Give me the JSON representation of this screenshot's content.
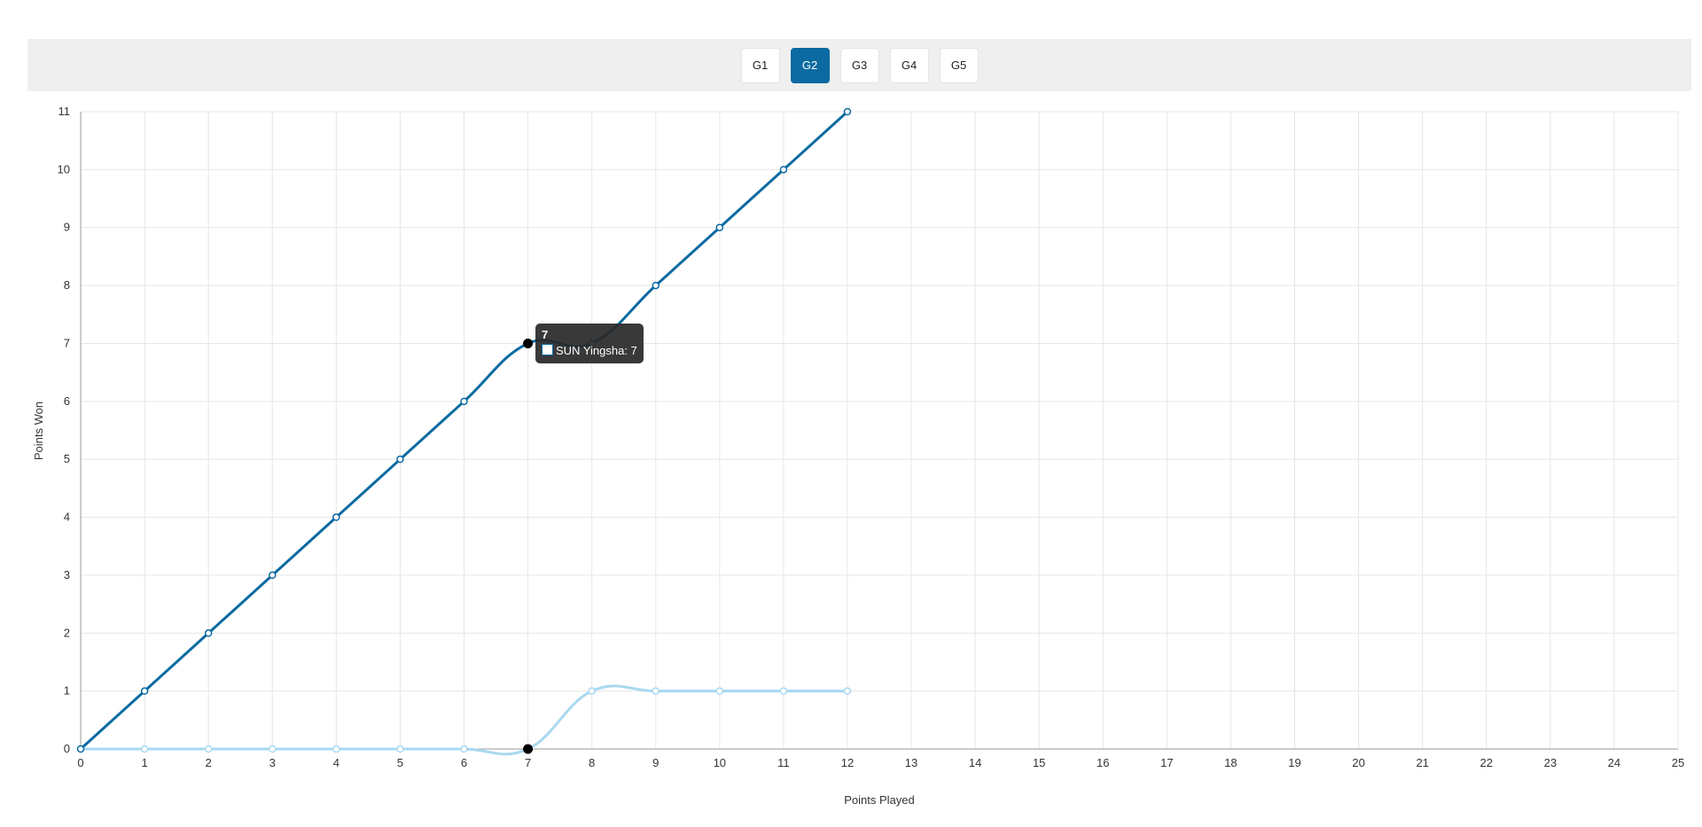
{
  "games": [
    {
      "label": "G1",
      "active": false
    },
    {
      "label": "G2",
      "active": true
    },
    {
      "label": "G3",
      "active": false
    },
    {
      "label": "G4",
      "active": false
    },
    {
      "label": "G5",
      "active": false
    }
  ],
  "tooltip": {
    "title": "7",
    "body": "SUN Yingsha: 7"
  },
  "chart_data": {
    "type": "line",
    "xlabel": "Points Played",
    "ylabel": "Points Won",
    "xlim": [
      0,
      25
    ],
    "ylim": [
      0,
      11
    ],
    "grid": true,
    "x": [
      0,
      1,
      2,
      3,
      4,
      5,
      6,
      7,
      8,
      9,
      10,
      11,
      12
    ],
    "series": [
      {
        "name": "SUN Yingsha",
        "color": "#0a6aa1",
        "values": [
          0,
          1,
          2,
          3,
          4,
          5,
          6,
          7,
          7,
          8,
          9,
          10,
          11
        ]
      },
      {
        "color": "#a8d8f0",
        "values": [
          0,
          0,
          0,
          0,
          0,
          0,
          0,
          0,
          1,
          1,
          1,
          1,
          1
        ]
      }
    ],
    "highlight_x": 7
  }
}
